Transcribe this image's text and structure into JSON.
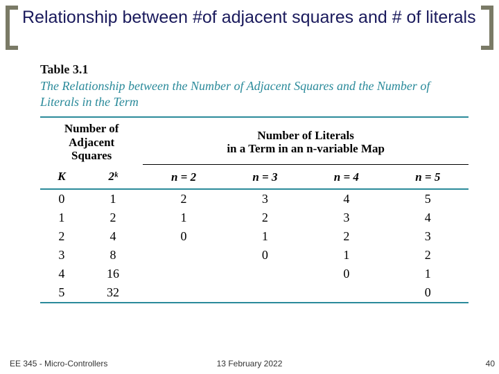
{
  "title": "Relationship between #of adjacent squares and # of literals",
  "table": {
    "label": "Table 3.1",
    "caption": "The Relationship between the Number of Adjacent Squares and the Number of Literals in the Term",
    "group_headers": {
      "left": "Number of\nAdjacent\nSquares",
      "right": "Number of Literals\nin a Term in an n-variable Map"
    },
    "sub_headers": [
      "K",
      "2ᵏ",
      "n = 2",
      "n = 3",
      "n = 4",
      "n = 5"
    ],
    "rows": [
      [
        "0",
        "1",
        "2",
        "3",
        "4",
        "5"
      ],
      [
        "1",
        "2",
        "1",
        "2",
        "3",
        "4"
      ],
      [
        "2",
        "4",
        "0",
        "1",
        "2",
        "3"
      ],
      [
        "3",
        "8",
        "",
        "0",
        "1",
        "2"
      ],
      [
        "4",
        "16",
        "",
        "",
        "0",
        "1"
      ],
      [
        "5",
        "32",
        "",
        "",
        "",
        "0"
      ]
    ]
  },
  "footer": {
    "course": "EE 345 - Micro-Controllers",
    "date": "13 February 2022",
    "page": "40"
  },
  "chart_data": {
    "type": "table",
    "title": "The Relationship between the Number of Adjacent Squares and the Number of Literals in the Term",
    "columns": [
      "K",
      "2^k",
      "n=2",
      "n=3",
      "n=4",
      "n=5"
    ],
    "rows": [
      [
        0,
        1,
        2,
        3,
        4,
        5
      ],
      [
        1,
        2,
        1,
        2,
        3,
        4
      ],
      [
        2,
        4,
        0,
        1,
        2,
        3
      ],
      [
        3,
        8,
        null,
        0,
        1,
        2
      ],
      [
        4,
        16,
        null,
        null,
        0,
        1
      ],
      [
        5,
        32,
        null,
        null,
        null,
        0
      ]
    ]
  }
}
